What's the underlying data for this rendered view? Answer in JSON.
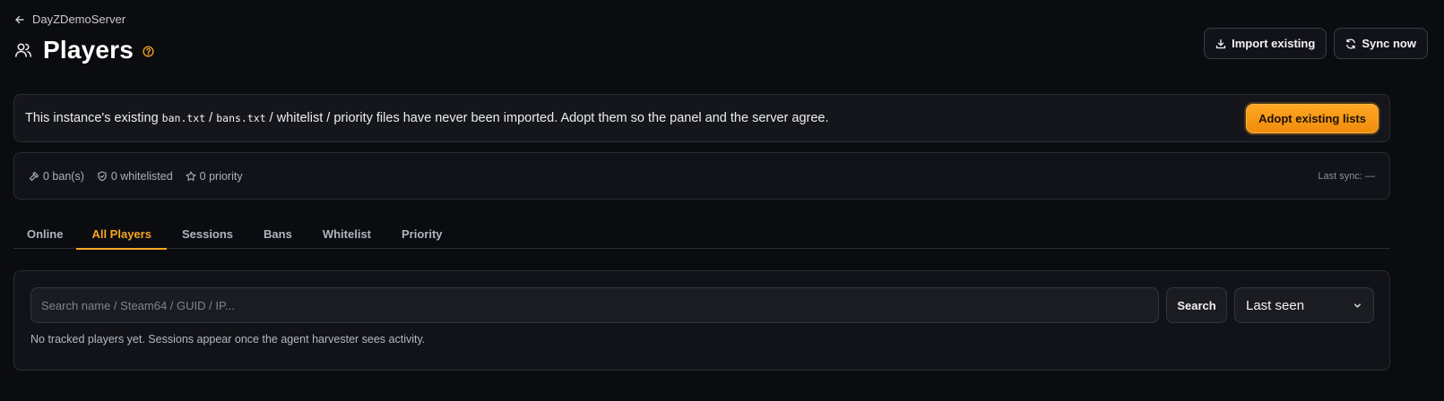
{
  "breadcrumb": {
    "back_label": "DayZDemoServer"
  },
  "header": {
    "title": "Players",
    "actions": {
      "import_label": "Import existing",
      "sync_label": "Sync now"
    }
  },
  "banner": {
    "text_pre": "This instance's existing ",
    "file1": "ban.txt",
    "sep1": " / ",
    "file2": "bans.txt",
    "text_post": " / whitelist / priority files have never been imported. Adopt them so the panel and the server agree.",
    "button_label": "Adopt existing lists"
  },
  "stats": {
    "bans": "0 ban(s)",
    "whitelisted": "0 whitelisted",
    "priority": "0 priority",
    "last_sync": "Last sync: —"
  },
  "tabs": [
    {
      "label": "Online"
    },
    {
      "label": "All Players",
      "active": true
    },
    {
      "label": "Sessions"
    },
    {
      "label": "Bans"
    },
    {
      "label": "Whitelist"
    },
    {
      "label": "Priority"
    }
  ],
  "players": {
    "search_placeholder": "Search name / Steam64 / GUID / IP...",
    "search_button": "Search",
    "sort_value": "Last seen",
    "empty_message": "No tracked players yet. Sessions appear once the agent harvester sees activity."
  },
  "colors": {
    "accent": "#f6a523",
    "background": "#0b0c10",
    "panel": "#121319",
    "border": "#2a2c33"
  },
  "icons": [
    "arrow-left-icon",
    "users-icon",
    "help-circle-icon",
    "download-icon",
    "refresh-icon",
    "hammer-icon",
    "shield-icon",
    "star-icon",
    "chevron-down-icon"
  ]
}
